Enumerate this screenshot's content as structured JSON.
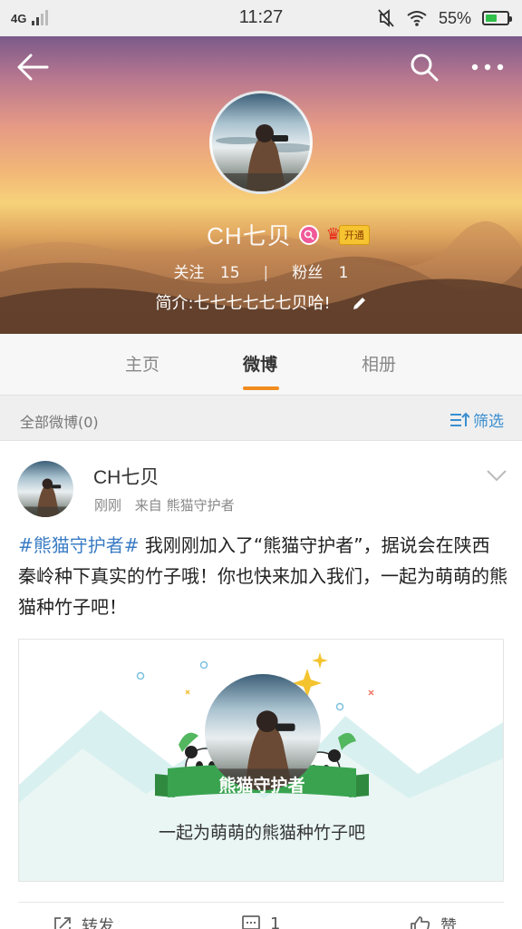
{
  "status_bar": {
    "network": "4G",
    "time": "11:27",
    "battery_percent": "55%",
    "battery_level": 0.55,
    "icons": [
      "signal-icon",
      "mute-icon",
      "wifi-icon",
      "battery-icon"
    ]
  },
  "header": {
    "icons": [
      "back-arrow-icon",
      "search-icon",
      "more-icon"
    ]
  },
  "profile": {
    "name": "CH七贝",
    "vip_label": "开通",
    "following_label": "关注",
    "following_count": "15",
    "followers_label": "粉丝",
    "followers_count": "1",
    "bio": "简介:七七七七七七贝哈!",
    "separator": "|"
  },
  "tabs": [
    {
      "label": "主页",
      "active": false
    },
    {
      "label": "微博",
      "active": true
    },
    {
      "label": "相册",
      "active": false
    }
  ],
  "filter": {
    "label": "全部微博(0)",
    "button": "筛选"
  },
  "post": {
    "author": "CH七贝",
    "time": "刚刚",
    "source": "来自 熊猫守护者",
    "hashtag": "#熊猫守护者#",
    "text": " 我刚刚加入了“熊猫守护者”，据说会在陕西秦岭种下真实的竹子哦！你也快来加入我们，一起为萌萌的熊猫种竹子吧！",
    "card": {
      "ribbon": "熊猫守护者",
      "caption": "一起为萌萌的熊猫种竹子吧"
    },
    "actions": {
      "repost": "转发",
      "comment": "1",
      "like": "赞"
    }
  },
  "colors": {
    "accent_orange": "#f08c1e",
    "link_blue": "#3a7cc4",
    "ribbon_green": "#3aa350"
  }
}
